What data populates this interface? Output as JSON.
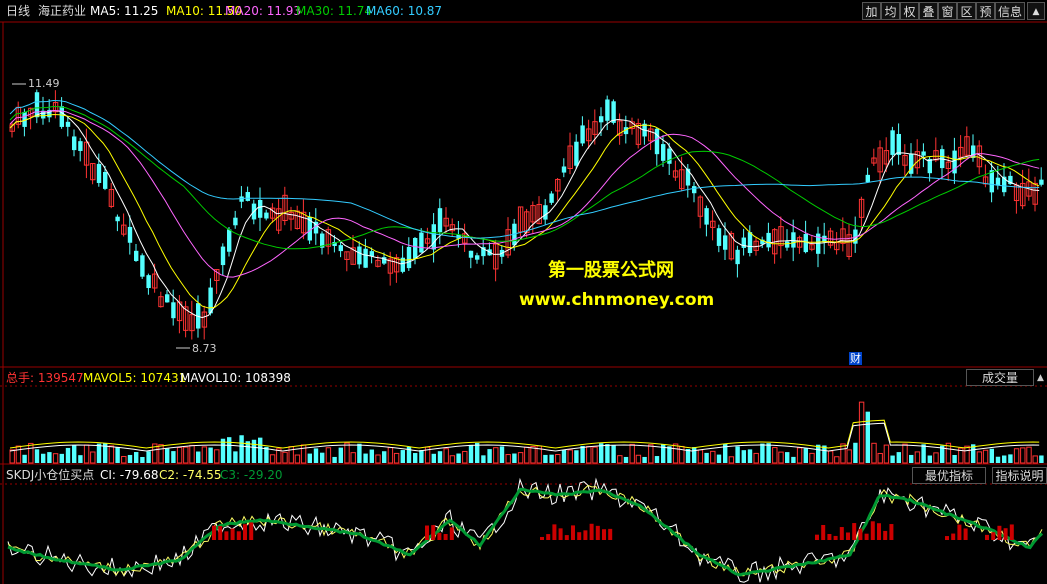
{
  "header": {
    "period": "日线",
    "stock_name": "海正药业",
    "ma": [
      {
        "label": "MA5: 11.25",
        "color": "#ffffff"
      },
      {
        "label": "MA10: 11.50",
        "color": "#ffff00"
      },
      {
        "label": "MA20: 11.93",
        "color": "#ff66ff"
      },
      {
        "label": "MA30: 11.74",
        "color": "#00cc00"
      },
      {
        "label": "MA60: 10.87",
        "color": "#33ccff"
      }
    ],
    "buttons": [
      "加",
      "均",
      "权",
      "叠",
      "窗",
      "区",
      "预",
      "信息"
    ],
    "close_glyph": "▲"
  },
  "price_panel": {
    "high_label": "11.49",
    "low_label": "8.73",
    "finance_marker": "财",
    "watermark_title": "第一股票公式网",
    "watermark_url": "www.chnmoney.com"
  },
  "volume_panel": {
    "total_label": "总手: 139547",
    "mavol5_label": "MAVOL5: 107431",
    "mavol10_label": "MAVOL10: 108398",
    "button": "成交量",
    "up_glyph": "▲"
  },
  "indicator_panel": {
    "name": "SKDJ小仓位买点",
    "c1_label": "CI: -79.68",
    "c2_label": "C2: -74.55",
    "c3_label": "C3: -29.20",
    "buttons": [
      "最优指标",
      "指标说明"
    ]
  },
  "colors": {
    "up": "#ff3333",
    "down": "#54ffff",
    "grid": "#990000",
    "c1": "#ffffff",
    "c2": "#ffff66",
    "c3": "#009933"
  }
}
